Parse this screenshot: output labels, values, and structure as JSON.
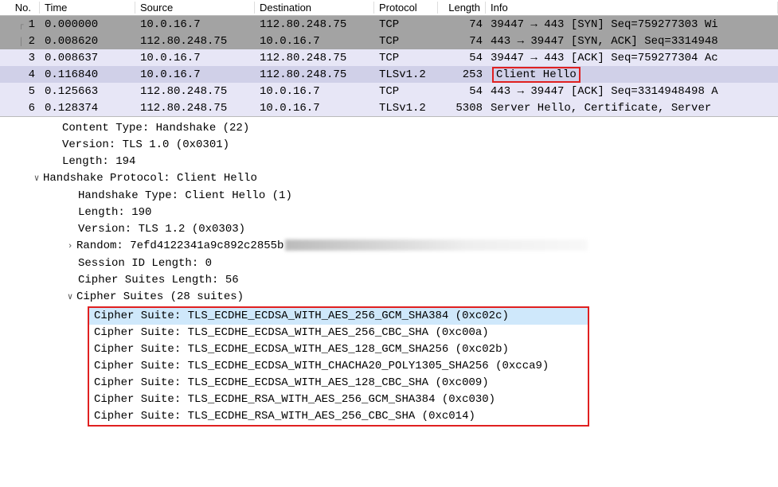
{
  "columns": {
    "no": "No.",
    "time": "Time",
    "src": "Source",
    "dst": "Destination",
    "proto": "Protocol",
    "len": "Length",
    "info": "Info"
  },
  "packets": [
    {
      "no": "1",
      "time": "0.000000",
      "src": "10.0.16.7",
      "dst": "112.80.248.75",
      "proto": "TCP",
      "len": "74",
      "info": "39447 → 443 [SYN] Seq=759277303 Wi",
      "bg": "bg-dark",
      "tree": "┌"
    },
    {
      "no": "2",
      "time": "0.008620",
      "src": "112.80.248.75",
      "dst": "10.0.16.7",
      "proto": "TCP",
      "len": "74",
      "info": "443 → 39447 [SYN, ACK] Seq=3314948",
      "bg": "bg-dark",
      "tree": "│"
    },
    {
      "no": "3",
      "time": "0.008637",
      "src": "10.0.16.7",
      "dst": "112.80.248.75",
      "proto": "TCP",
      "len": "54",
      "info": "39447 → 443 [ACK] Seq=759277304 Ac",
      "bg": "bg-light",
      "tree": ""
    },
    {
      "no": "4",
      "time": "0.116840",
      "src": "10.0.16.7",
      "dst": "112.80.248.75",
      "proto": "TLSv1.2",
      "len": "253",
      "info": "Client Hello",
      "bg": "bg-sel",
      "boxed": true,
      "tree": ""
    },
    {
      "no": "5",
      "time": "0.125663",
      "src": "112.80.248.75",
      "dst": "10.0.16.7",
      "proto": "TCP",
      "len": "54",
      "info": "443 → 39447 [ACK] Seq=3314948498 A",
      "bg": "bg-light",
      "tree": ""
    },
    {
      "no": "6",
      "time": "0.128374",
      "src": "112.80.248.75",
      "dst": "10.0.16.7",
      "proto": "TLSv1.2",
      "len": "5308",
      "info": "Server Hello, Certificate, Server ",
      "bg": "bg-light",
      "tree": ""
    }
  ],
  "details": {
    "content_type": "Content Type: Handshake (22)",
    "version_rec": "Version: TLS 1.0 (0x0301)",
    "length_rec": "Length: 194",
    "hs_proto": "Handshake Protocol: Client Hello",
    "hs_type": "Handshake Type: Client Hello (1)",
    "hs_len": "Length: 190",
    "hs_ver": "Version: TLS 1.2 (0x0303)",
    "random": "Random: 7efd4122341a9c892c2855b",
    "sid_len": "Session ID Length: 0",
    "cs_len_line": "Cipher Suites Length: 56",
    "cs_header": "Cipher Suites (28 suites)"
  },
  "cipher_suites": [
    "Cipher Suite: TLS_ECDHE_ECDSA_WITH_AES_256_GCM_SHA384 (0xc02c)",
    "Cipher Suite: TLS_ECDHE_ECDSA_WITH_AES_256_CBC_SHA (0xc00a)",
    "Cipher Suite: TLS_ECDHE_ECDSA_WITH_AES_128_GCM_SHA256 (0xc02b)",
    "Cipher Suite: TLS_ECDHE_ECDSA_WITH_CHACHA20_POLY1305_SHA256 (0xcca9)",
    "Cipher Suite: TLS_ECDHE_ECDSA_WITH_AES_128_CBC_SHA (0xc009)",
    "Cipher Suite: TLS_ECDHE_RSA_WITH_AES_256_GCM_SHA384 (0xc030)",
    "Cipher Suite: TLS_ECDHE_RSA_WITH_AES_256_CBC_SHA (0xc014)"
  ]
}
